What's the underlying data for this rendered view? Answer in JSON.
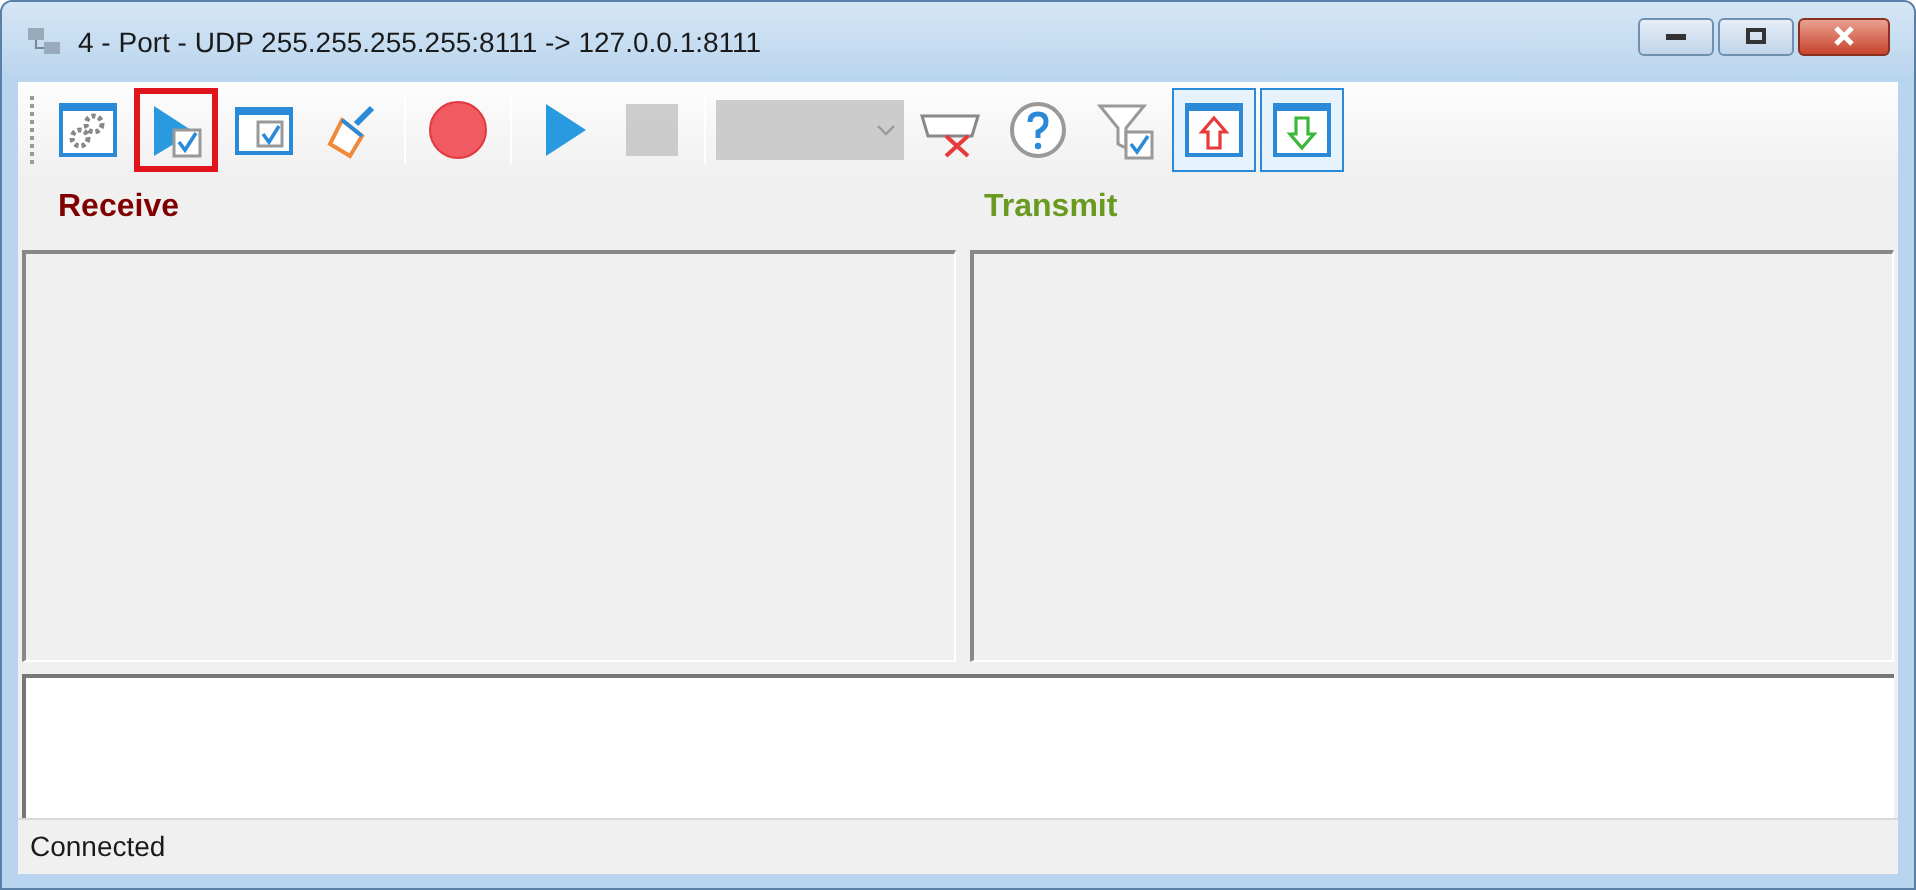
{
  "window": {
    "title": "4 - Port - UDP 255.255.255.255:8111 -> 127.0.0.1:8111"
  },
  "toolbar": [
    {
      "kind": "settings",
      "checked": false,
      "focused": false,
      "disabled": false
    },
    {
      "kind": "play-check",
      "checked": false,
      "focused": true,
      "disabled": false
    },
    {
      "kind": "window-check",
      "checked": false,
      "focused": false,
      "disabled": false
    },
    {
      "kind": "brush",
      "checked": false,
      "focused": false,
      "disabled": false
    },
    {
      "kind": "separator"
    },
    {
      "kind": "record",
      "checked": false,
      "focused": false,
      "disabled": false
    },
    {
      "kind": "separator"
    },
    {
      "kind": "play",
      "checked": false,
      "focused": false,
      "disabled": false
    },
    {
      "kind": "stop",
      "checked": false,
      "focused": false,
      "disabled": true
    },
    {
      "kind": "separator"
    },
    {
      "kind": "dropdown",
      "disabled": true
    },
    {
      "kind": "port-disconnect",
      "checked": false,
      "focused": false,
      "disabled": false
    },
    {
      "kind": "help",
      "checked": false,
      "focused": false,
      "disabled": false
    },
    {
      "kind": "filter-check",
      "checked": false,
      "focused": false,
      "disabled": false
    },
    {
      "kind": "up",
      "checked": true,
      "focused": false,
      "disabled": false
    },
    {
      "kind": "down",
      "checked": true,
      "focused": false,
      "disabled": false
    }
  ],
  "receive": {
    "label": "Receive"
  },
  "transmit": {
    "label": "Transmit"
  },
  "status_bar": {
    "text": "Connected"
  }
}
